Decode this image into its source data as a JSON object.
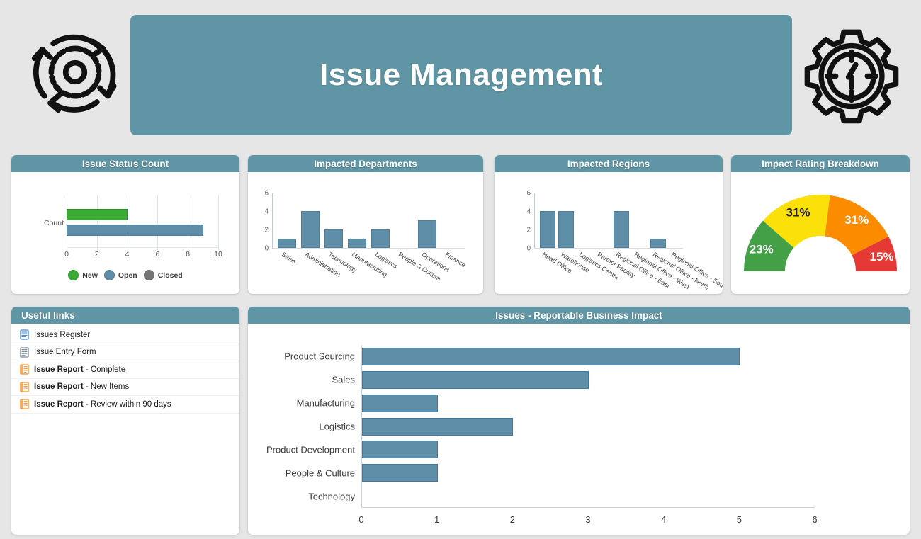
{
  "header": {
    "title": "Issue Management",
    "banner_color": "#5f95a4",
    "left_icon": "process-cycle-gear-icon",
    "right_icon": "gear-target-icon"
  },
  "panels": {
    "status": {
      "title": "Issue Status Count"
    },
    "departments": {
      "title": "Impacted Departments"
    },
    "regions": {
      "title": "Impacted Regions"
    },
    "gauge": {
      "title": "Impact Rating Breakdown"
    },
    "links": {
      "title": "Useful links"
    },
    "impact": {
      "title": "Issues - Reportable Business Impact"
    }
  },
  "useful_links": {
    "items": [
      {
        "label": "Issues Register",
        "prefix": "",
        "icon": "document-list-icon",
        "icon_color": "#4a90d9"
      },
      {
        "label": "Issue Entry Form",
        "prefix": "",
        "icon": "form-icon",
        "icon_color": "#808b94"
      },
      {
        "label": "Issue Report - Complete",
        "prefix": "Issue Report",
        "suffix": " - Complete",
        "icon": "report-icon",
        "icon_color": "#f0922b"
      },
      {
        "label": "Issue Report - New Items",
        "prefix": "Issue Report",
        "suffix": " - New Items",
        "icon": "report-icon",
        "icon_color": "#f0922b"
      },
      {
        "label": "Issue Report - Review within 90 days",
        "prefix": "Issue Report",
        "suffix": " - Review within 90 days",
        "icon": "report-icon",
        "icon_color": "#f0922b"
      }
    ]
  },
  "chart_data": [
    {
      "id": "issue_status_count",
      "type": "bar",
      "orientation": "horizontal",
      "title": "Issue Status Count",
      "categories": [
        "Count"
      ],
      "series": [
        {
          "name": "New",
          "values": [
            4
          ],
          "color": "#3aaa35"
        },
        {
          "name": "Open",
          "values": [
            9
          ],
          "color": "#5f8fa8"
        },
        {
          "name": "Closed",
          "values": [
            0
          ],
          "color": "#757575"
        }
      ],
      "xlabel": "",
      "ylabel": "",
      "xlim": [
        0,
        10
      ],
      "xticks": [
        0,
        2,
        4,
        6,
        8,
        10
      ],
      "grid": true,
      "legend": "bottom"
    },
    {
      "id": "impacted_departments",
      "type": "bar",
      "orientation": "vertical",
      "title": "Impacted Departments",
      "categories": [
        "Sales",
        "Administration",
        "Technology",
        "Manufacturing",
        "Logistics",
        "People & Culture",
        "Operations",
        "Finance"
      ],
      "values": [
        1,
        4,
        2,
        1,
        2,
        0,
        3,
        0
      ],
      "color": "#5f8fa8",
      "xlabel": "",
      "ylabel": "",
      "ylim": [
        0,
        6
      ],
      "yticks": [
        0,
        2,
        4,
        6
      ],
      "grid": false,
      "legend": "none"
    },
    {
      "id": "impacted_regions",
      "type": "bar",
      "orientation": "vertical",
      "title": "Impacted Regions",
      "categories": [
        "Head Office",
        "Warehouse",
        "Logistics Centre",
        "Partner Facility",
        "Regional Office - East",
        "Regional Office - West",
        "Regional Office - North",
        "Regional Office - South"
      ],
      "values": [
        4,
        4,
        0,
        0,
        4,
        0,
        1,
        0
      ],
      "color": "#5f8fa8",
      "xlabel": "",
      "ylabel": "",
      "ylim": [
        0,
        6
      ],
      "yticks": [
        0,
        2,
        4,
        6
      ],
      "grid": false,
      "legend": "none"
    },
    {
      "id": "impact_rating_breakdown",
      "type": "pie",
      "variant": "half-donut-gauge",
      "title": "Impact Rating Breakdown",
      "labels": [
        "23%",
        "31%",
        "31%",
        "15%"
      ],
      "values": [
        23,
        31,
        31,
        15
      ],
      "colors": [
        "#43a047",
        "#fbe009",
        "#fb8c00",
        "#e53935"
      ],
      "label_colors": [
        "#ffffff",
        "#222222",
        "#ffffff",
        "#ffffff"
      ],
      "legend": "none"
    },
    {
      "id": "issues_reportable_business_impact",
      "type": "bar",
      "orientation": "horizontal",
      "title": "Issues - Reportable Business Impact",
      "categories": [
        "Product Sourcing",
        "Sales",
        "Manufacturing",
        "Logistics",
        "Product Development",
        "People & Culture",
        "Technology"
      ],
      "values": [
        5,
        3,
        1,
        2,
        1,
        1,
        0
      ],
      "color": "#5f8fa8",
      "xlabel": "",
      "ylabel": "",
      "xlim": [
        0,
        6
      ],
      "xticks": [
        0,
        1,
        2,
        3,
        4,
        5,
        6
      ],
      "grid": false,
      "legend": "none"
    }
  ]
}
